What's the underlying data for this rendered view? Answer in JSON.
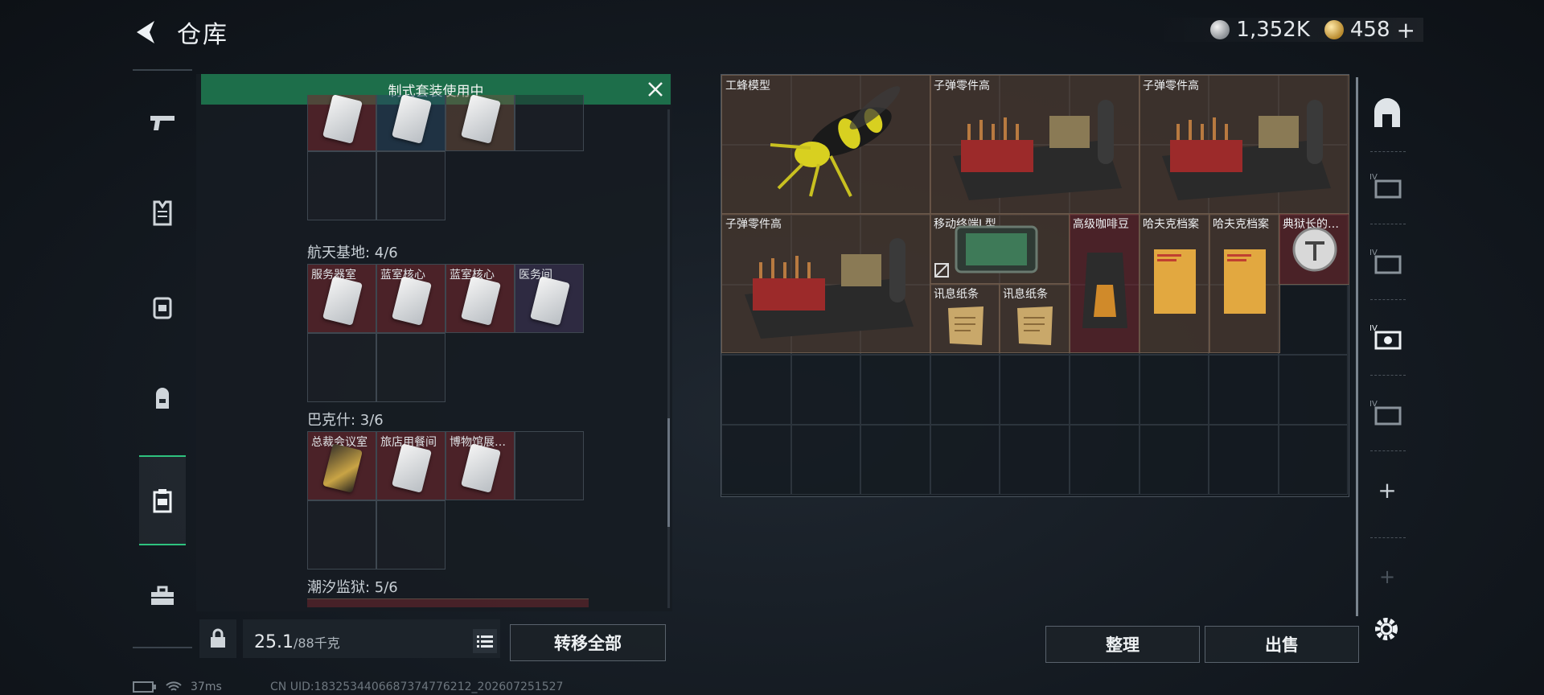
{
  "header": {
    "title": "仓库",
    "silver_amount": "1,352K",
    "gold_amount": "458",
    "plus": "+"
  },
  "left_nav": [
    "gun-icon",
    "armor-icon",
    "chest-rig-icon",
    "backpack-icon",
    "case-icon",
    "toolbox-icon"
  ],
  "banner": {
    "text": "制式套装使用中"
  },
  "groups": [
    {
      "title": "",
      "items": [
        {
          "label": "",
          "tint": "red"
        },
        {
          "label": "",
          "tint": "blue"
        },
        {
          "label": "",
          "tint": "tan"
        },
        {
          "label": "",
          "tint": "empty"
        }
      ]
    },
    {
      "title": "航天基地: 4/6",
      "items": [
        {
          "label": "服务器室",
          "tint": "red"
        },
        {
          "label": "蓝室核心",
          "tint": "red"
        },
        {
          "label": "蓝室核心",
          "tint": "red"
        },
        {
          "label": "医务间",
          "tint": "purple"
        }
      ]
    },
    {
      "title": "巴克什: 3/6",
      "items": [
        {
          "label": "总裁会议室",
          "tint": "red"
        },
        {
          "label": "旅店用餐间",
          "tint": "red"
        },
        {
          "label": "博物馆展…",
          "tint": "red"
        },
        {
          "label": "",
          "tint": "empty"
        }
      ]
    },
    {
      "title": "潮汐监狱: 5/6"
    }
  ],
  "weight": {
    "current": "25.1",
    "max": "/88千克"
  },
  "buttons": {
    "transfer_all": "转移全部",
    "organize": "整理",
    "sell": "出售"
  },
  "stash_items": [
    {
      "label": "工蜂模型"
    },
    {
      "label": "子弹零件高"
    },
    {
      "label": "子弹零件高"
    },
    {
      "label": "子弹零件高"
    },
    {
      "label": "移动终端L型"
    },
    {
      "label": "高级咖啡豆"
    },
    {
      "label": "哈夫克档案"
    },
    {
      "label": "哈夫克档案"
    },
    {
      "label": "典狱长的…"
    },
    {
      "label": "讯息纸条"
    },
    {
      "label": "讯息纸条"
    }
  ],
  "right_nav": {
    "plus": "+",
    "plus_dim": "+"
  },
  "status": {
    "ping": "37ms",
    "uid": "CN UID:1832534406687374776212_202607251527"
  }
}
